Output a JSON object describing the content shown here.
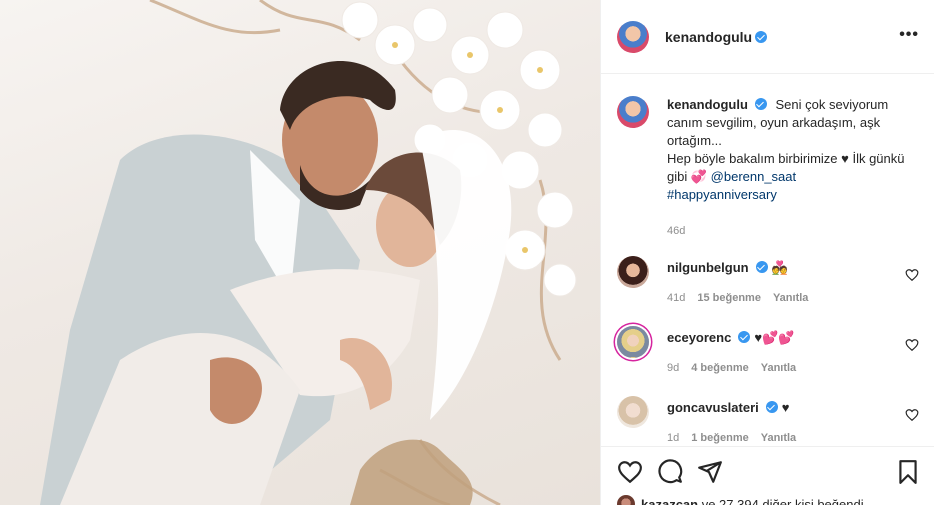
{
  "post": {
    "author": "kenandogulu",
    "caption": {
      "line1": "Seni çok seviyorum canım sevgilim, oyun arkadaşım, aşk ortağım...",
      "line2_prefix": "Hep böyle bakalım birbirimize ♥ İlk günkü gibi 💞 ",
      "mention": "@berenn_saat",
      "hashtag": "#happyanniversary"
    },
    "age": "46d"
  },
  "comments": [
    {
      "user": "nilgunbelgun",
      "text": "💑",
      "age": "41d",
      "likes": "15 beğenme",
      "reply": "Yanıtla"
    },
    {
      "user": "eceyorenc",
      "text": "♥💕💕",
      "age": "9d",
      "likes": "4 beğenme",
      "reply": "Yanıtla"
    },
    {
      "user": "goncavuslateri",
      "text": "♥",
      "age": "1d",
      "likes": "1 beğenme",
      "reply": "Yanıtla"
    }
  ],
  "likes_summary": {
    "user": "kazazcan",
    "rest": " ve 27.394 diğer kişi beğendi"
  },
  "icons": {
    "more": "more-options-icon",
    "like": "heart-icon",
    "comment": "comment-icon",
    "share": "share-icon",
    "save": "bookmark-icon"
  },
  "colors": {
    "verified": "#3897f0",
    "link": "#00376b",
    "muted": "#8e8e8e"
  }
}
